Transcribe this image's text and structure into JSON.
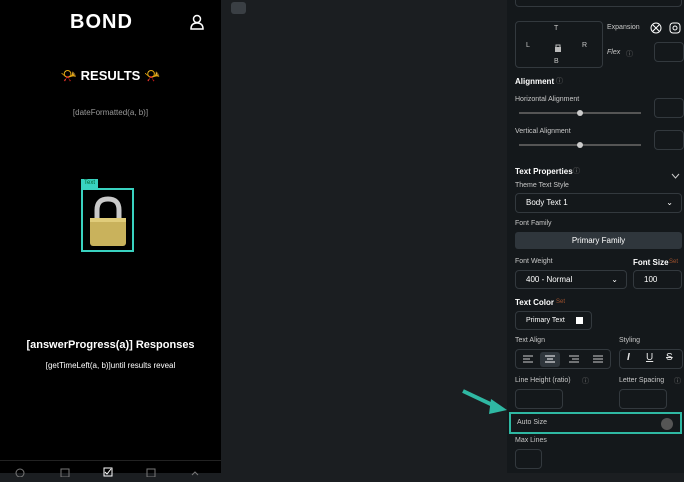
{
  "app": {
    "logo": "BOND",
    "results_title": "📯 RESULTS 📯",
    "date_text": "[dateFormatted(a, b)]",
    "text_tag": "Text",
    "answer_title": "[answerProgress(a)] Responses",
    "time_left": "[getTimeLeft(a, b)]until results reveal"
  },
  "panel": {
    "pad": {
      "top": "T",
      "left": "L",
      "right": "R",
      "bottom": "B"
    },
    "expansion_label": "Expansion",
    "flex_label": "Flex",
    "alignment_header": "Alignment",
    "horizontal_alignment": "Horizontal Alignment",
    "vertical_alignment": "Vertical Alignment",
    "text_properties_header": "Text Properties",
    "theme_text_style_label": "Theme Text Style",
    "theme_text_style_value": "Body Text 1",
    "font_family_label": "Font Family",
    "font_family_value": "Primary Family",
    "font_weight_label": "Font Weight",
    "font_weight_value": "400 - Normal",
    "font_size_label": "Font Size",
    "set_label": "Set",
    "font_size_value": "100",
    "text_color_label": "Text Color",
    "text_color_value": "Primary Text",
    "text_align_label": "Text Align",
    "styling_label": "Styling",
    "line_height_label": "Line Height (ratio)",
    "letter_spacing_label": "Letter Spacing",
    "auto_size_label": "Auto Size",
    "max_lines_label": "Max Lines"
  },
  "colors": {
    "accent": "#39d2c0",
    "highlight": "#2fb8a3"
  }
}
